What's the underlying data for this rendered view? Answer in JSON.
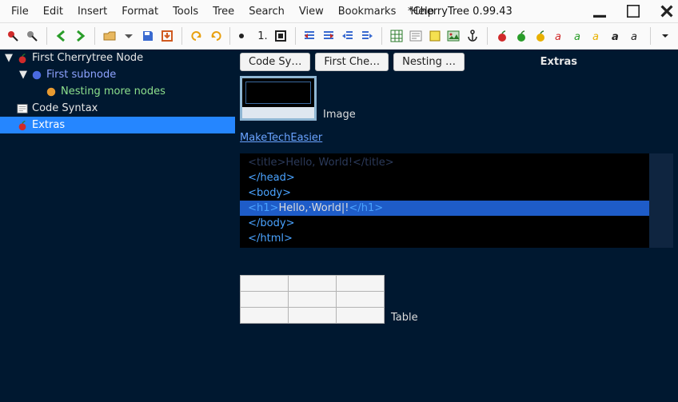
{
  "window": {
    "title": "*CherryTree 0.99.43"
  },
  "menu": {
    "items": [
      "File",
      "Edit",
      "Insert",
      "Format",
      "Tools",
      "Tree",
      "Search",
      "View",
      "Bookmarks",
      "Help"
    ]
  },
  "toolbar": {
    "list_num": "1."
  },
  "tree": {
    "nodes": [
      {
        "label": "First Cherrytree Node",
        "depth": 0,
        "expanded": true,
        "icon": "cherry",
        "cls": ""
      },
      {
        "label": "First subnode",
        "depth": 1,
        "expanded": true,
        "icon": "blue-sphere",
        "cls": "sub"
      },
      {
        "label": "Nesting more nodes",
        "depth": 2,
        "expanded": false,
        "icon": "orange-sphere",
        "cls": "nest"
      },
      {
        "label": "Code Syntax",
        "depth": 0,
        "expanded": false,
        "icon": "code",
        "cls": ""
      },
      {
        "label": "Extras",
        "depth": 0,
        "expanded": false,
        "icon": "cherry",
        "cls": "",
        "selected": true
      }
    ]
  },
  "content": {
    "tabs": [
      "Code Sy…",
      "First Che…",
      "Nesting …"
    ],
    "active_title": "Extras",
    "image_label": "Image",
    "link_text": "MakeTechEasier",
    "code_lines": [
      {
        "raw": "<title>Hello, World!</title>",
        "faint": true
      },
      {
        "raw": "</head>"
      },
      {
        "raw": "<body>"
      },
      {
        "raw": "<h1>Hello,·World|!</h1>",
        "selected": true
      },
      {
        "raw": "</body>"
      },
      {
        "raw": "</html>"
      }
    ],
    "table_label": "Table",
    "table": {
      "rows": 3,
      "cols": 3
    }
  }
}
